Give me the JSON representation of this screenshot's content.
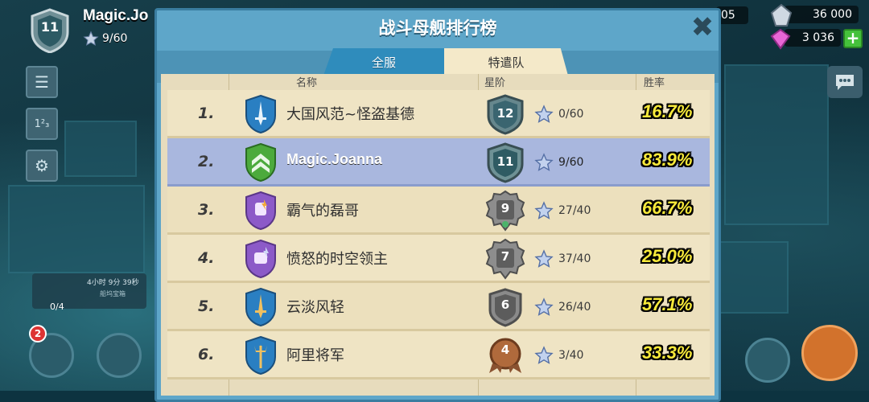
{
  "player": {
    "level": "11",
    "name": "Magic.Jo",
    "stars": "9/60"
  },
  "resources": {
    "left_value": "05",
    "iron": "36 000",
    "gems": "3 036",
    "plus": "+"
  },
  "chest": {
    "timer": "4小时 9分 39秒",
    "label": "船坞宝箱",
    "count": "0/4"
  },
  "notification_count": "2",
  "panel": {
    "title": "战斗母舰排行榜",
    "close": "✖",
    "tabs": [
      {
        "label": "全服"
      },
      {
        "label": "特遣队"
      }
    ],
    "headers": {
      "name": "名称",
      "rank": "星阶",
      "winrate": "胜率"
    }
  },
  "rows": [
    {
      "pos": "1.",
      "name": "大国风范~怪盗基德",
      "level": "12",
      "stars": "0/60",
      "winrate": "16.7%"
    },
    {
      "pos": "2.",
      "name": "Magic.Joanna",
      "level": "11",
      "stars": "9/60",
      "winrate": "83.9%"
    },
    {
      "pos": "3.",
      "name": "霸气的磊哥",
      "level": "9",
      "stars": "27/40",
      "winrate": "66.7%"
    },
    {
      "pos": "4.",
      "name": "愤怒的时空领主",
      "level": "7",
      "stars": "37/40",
      "winrate": "25.0%"
    },
    {
      "pos": "5.",
      "name": "云淡风轻",
      "level": "6",
      "stars": "26/40",
      "winrate": "57.1%"
    },
    {
      "pos": "6.",
      "name": "阿里将军",
      "level": "4",
      "stars": "3/40",
      "winrate": "33.3%"
    }
  ]
}
